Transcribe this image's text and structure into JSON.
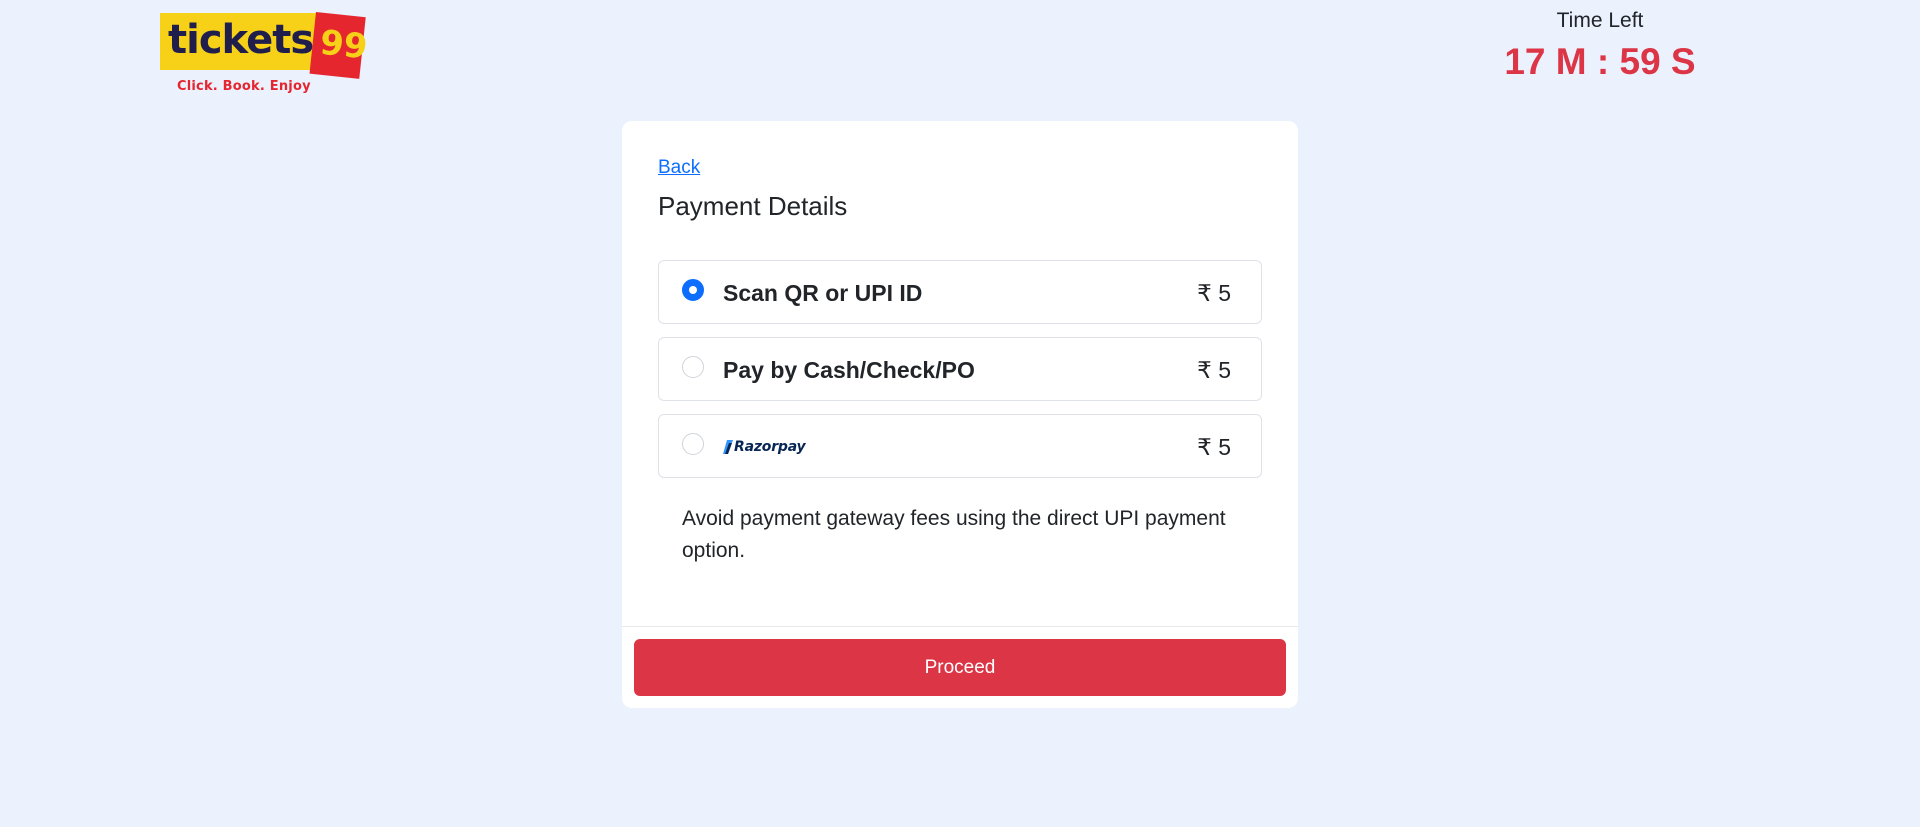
{
  "brand": {
    "logo_word": "tickets",
    "logo_number": "99",
    "tagline": "Click. Book. Enjoy"
  },
  "timer": {
    "label": "Time Left",
    "value": "17 M : 59 S"
  },
  "payment": {
    "back_label": "Back",
    "title": "Payment Details",
    "options": [
      {
        "label": "Scan QR or UPI ID",
        "price": "₹ 5",
        "selected": true
      },
      {
        "label": "Pay by Cash/Check/PO",
        "price": "₹ 5",
        "selected": false
      },
      {
        "label": "Razorpay",
        "price": "₹ 5",
        "selected": false,
        "icon": "razorpay-logo"
      }
    ],
    "hint": "Avoid payment gateway fees using the direct UPI payment option.",
    "proceed_label": "Proceed"
  },
  "colors": {
    "page_background": "#ebf1fd",
    "accent_red": "#dc3545",
    "link_blue": "#0d6efd",
    "logo_yellow": "#f6d117",
    "logo_red": "#e5262f"
  }
}
